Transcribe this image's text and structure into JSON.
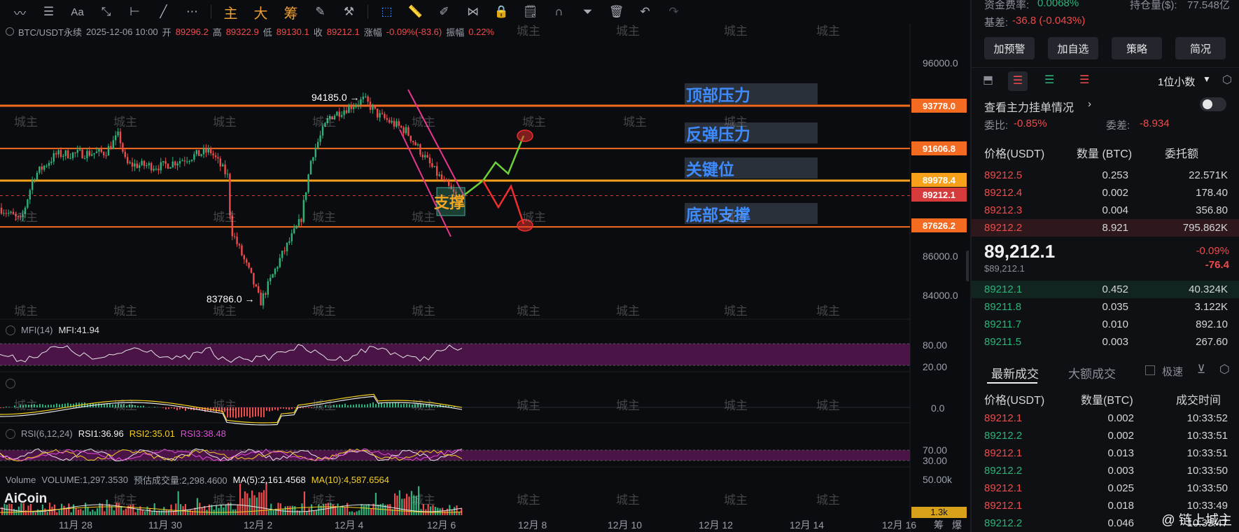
{
  "toolbar": {
    "icons": [
      "wave-icon",
      "lines-icon",
      "text-icon",
      "brush-off-icon",
      "horizontal-ray-icon",
      "trend-line-icon",
      "more-icon"
    ],
    "cn_buttons": [
      "主",
      "大",
      "筹"
    ],
    "right_icons": [
      "draw-icon",
      "tools-icon",
      "cursor-icon",
      "ruler-icon",
      "pen-icon",
      "pattern-icon",
      "lock-icon",
      "note-icon",
      "magnet-icon",
      "filter-icon",
      "trash-icon",
      "undo-icon",
      "redo-icon"
    ]
  },
  "info": {
    "symbol": "BTC/USDT永续",
    "datetime": "2025-12-06 10:00",
    "open_k": "开",
    "open": "89296.2",
    "high_k": "高",
    "high": "89322.9",
    "low_k": "低",
    "low": "89130.1",
    "close_k": "收",
    "close": "89212.1",
    "change_k": "涨幅",
    "change": "-0.09%(-83.6)",
    "amp_k": "振幅",
    "amp": "0.22%"
  },
  "price_axis": [
    "96000.0",
    "86000.0",
    "84000.0"
  ],
  "price_tags": [
    {
      "value": "93778.0",
      "color": "#f26b21"
    },
    {
      "value": "91606.8",
      "color": "#f26b21"
    },
    {
      "value": "89978.4",
      "color": "#f7a11a"
    },
    {
      "value": "89212.1",
      "color": "#d73a3a"
    },
    {
      "value": "87626.2",
      "color": "#f26b21"
    }
  ],
  "annotations": {
    "high": "94185.0 →",
    "low": "83786.0 →",
    "support": "支撑",
    "zones": [
      "顶部压力",
      "反弹压力",
      "关键位",
      "底部支撑"
    ]
  },
  "indicators": {
    "mfi": {
      "name": "MFI(14)",
      "value": "MFI:41.94",
      "levels": [
        "80.00",
        "20.00"
      ]
    },
    "macd": {
      "level": "0.0"
    },
    "rsi": {
      "name": "RSI(6,12,24)",
      "rsi1": "RSI1:36.96",
      "rsi2": "RSI2:35.01",
      "rsi3": "RSI3:38.48",
      "levels": [
        "70.00",
        "30.00"
      ]
    },
    "volume": {
      "name": "Volume",
      "vol": "VOLUME:1,297.3530",
      "est": "预估成交量:2,298.4600",
      "ma5": "MA(5):2,161.4568",
      "ma10": "MA(10):4,587.6564",
      "levels": [
        "50.00k",
        "1.3k"
      ]
    }
  },
  "x_axis": [
    "11月 28",
    "11月 30",
    "12月 2",
    "12月 4",
    "12月 6",
    "12月 8",
    "12月 10",
    "12月 12",
    "12月 14",
    "12月 16"
  ],
  "x_axis_extra": [
    "筹",
    "爆"
  ],
  "logo": "AiCoin",
  "watermark": "城主",
  "footer_watermark": "@ 链上城主",
  "panel": {
    "top_cut": [
      {
        "k": "资金费率:",
        "v": "0.0068%",
        "k2": "持仓量($):",
        "v2": "77.548亿"
      },
      {
        "k": "基差:",
        "v": "-36.8 (-0.043%)"
      }
    ],
    "buttons": [
      "加预警",
      "加自选",
      "策略",
      "简况"
    ],
    "decimals": "1位小数",
    "main_order": "查看主力挂单情况",
    "ratio_k": "委比:",
    "ratio": "-0.85%",
    "diff_k": "委差:",
    "diff": "-8.934",
    "book_headers": [
      "价格(USDT)",
      "数量 (BTC)",
      "委托额"
    ],
    "asks": [
      {
        "price": "89212.5",
        "qty": "0.253",
        "amt": "22.571K"
      },
      {
        "price": "89212.4",
        "qty": "0.002",
        "amt": "178.40"
      },
      {
        "price": "89212.3",
        "qty": "0.004",
        "amt": "356.80"
      },
      {
        "price": "89212.2",
        "qty": "8.921",
        "amt": "795.862K"
      }
    ],
    "last_price": "89,212.1",
    "last_usd": "$89,212.1",
    "last_pct": "-0.09%",
    "last_chg": "-76.4",
    "bids": [
      {
        "price": "89212.1",
        "qty": "0.452",
        "amt": "40.324K"
      },
      {
        "price": "89211.8",
        "qty": "0.035",
        "amt": "3.122K"
      },
      {
        "price": "89211.7",
        "qty": "0.010",
        "amt": "892.10"
      },
      {
        "price": "89211.5",
        "qty": "0.003",
        "amt": "267.60"
      }
    ],
    "tabs": [
      "最新成交",
      "大额成交"
    ],
    "fast": "极速",
    "trade_headers": [
      "价格(USDT)",
      "数量(BTC)",
      "成交时间"
    ],
    "trades": [
      {
        "price": "89212.1",
        "qty": "0.002",
        "time": "10:33:52",
        "side": "red"
      },
      {
        "price": "89212.2",
        "qty": "0.002",
        "time": "10:33:51",
        "side": "green"
      },
      {
        "price": "89212.1",
        "qty": "0.013",
        "time": "10:33:51",
        "side": "red"
      },
      {
        "price": "89212.2",
        "qty": "0.003",
        "time": "10:33:50",
        "side": "green"
      },
      {
        "price": "89212.1",
        "qty": "0.025",
        "time": "10:33:50",
        "side": "red"
      },
      {
        "price": "89212.1",
        "qty": "0.018",
        "time": "10:33:49",
        "side": "red"
      },
      {
        "price": "89212.2",
        "qty": "0.046",
        "time": "10:33:47",
        "side": "green"
      }
    ]
  }
}
